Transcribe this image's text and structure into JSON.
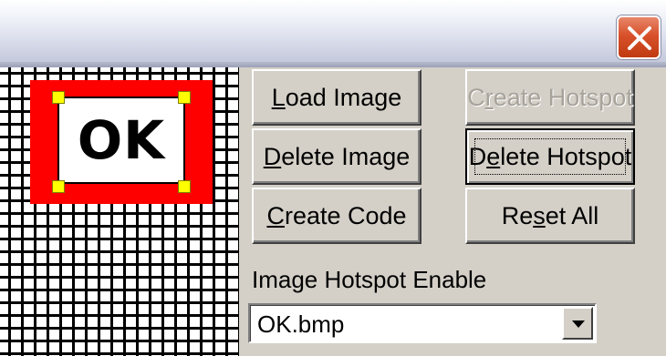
{
  "window": {
    "close_icon": "close-icon"
  },
  "preview": {
    "image_text": "OK",
    "bg_color": "#ff0000",
    "handle_color": "#ffff00"
  },
  "buttons": {
    "load_image_pre": "",
    "load_image_key": "L",
    "load_image_post": "oad Image",
    "delete_image_pre": "",
    "delete_image_key": "D",
    "delete_image_post": "elete Image",
    "create_code_pre": "",
    "create_code_key": "C",
    "create_code_post": "reate Code",
    "create_hotspot_pre": "C",
    "create_hotspot_key": "r",
    "create_hotspot_post": "eate Hotspot",
    "delete_hotspot_pre": "D",
    "delete_hotspot_key": "e",
    "delete_hotspot_post": "lete Hotspot",
    "reset_all_pre": "Re",
    "reset_all_key": "s",
    "reset_all_post": "et All"
  },
  "hotspot": {
    "label": "Image Hotspot Enable",
    "selected": "OK.bmp"
  }
}
